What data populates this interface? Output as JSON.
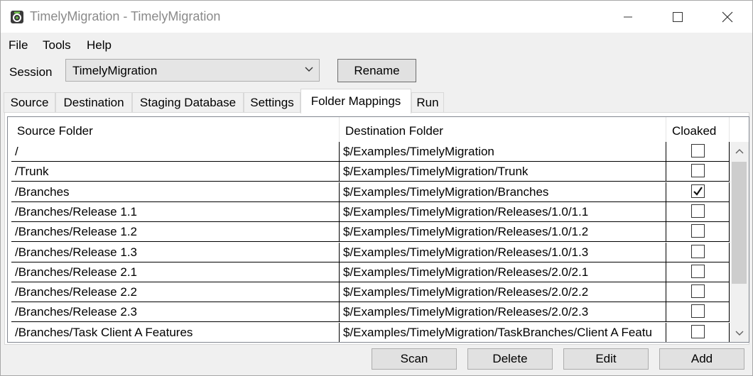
{
  "window": {
    "title": "TimelyMigration - TimelyMigration"
  },
  "menu": {
    "items": [
      "File",
      "Tools",
      "Help"
    ]
  },
  "session": {
    "label": "Session",
    "value": "TimelyMigration",
    "rename_label": "Rename"
  },
  "tabs": [
    {
      "label": "Source",
      "active": false
    },
    {
      "label": "Destination",
      "active": false
    },
    {
      "label": "Staging Database",
      "active": false
    },
    {
      "label": "Settings",
      "active": false
    },
    {
      "label": "Folder Mappings",
      "active": true
    },
    {
      "label": "Run",
      "active": false
    }
  ],
  "grid": {
    "columns": [
      "Source Folder",
      "Destination Folder",
      "Cloaked"
    ],
    "rows": [
      {
        "source": "/",
        "destination": "$/Examples/TimelyMigration",
        "cloaked": false
      },
      {
        "source": "/Trunk",
        "destination": "$/Examples/TimelyMigration/Trunk",
        "cloaked": false
      },
      {
        "source": "/Branches",
        "destination": "$/Examples/TimelyMigration/Branches",
        "cloaked": true
      },
      {
        "source": "/Branches/Release 1.1",
        "destination": "$/Examples/TimelyMigration/Releases/1.0/1.1",
        "cloaked": false
      },
      {
        "source": "/Branches/Release 1.2",
        "destination": "$/Examples/TimelyMigration/Releases/1.0/1.2",
        "cloaked": false
      },
      {
        "source": "/Branches/Release 1.3",
        "destination": "$/Examples/TimelyMigration/Releases/1.0/1.3",
        "cloaked": false
      },
      {
        "source": "/Branches/Release 2.1",
        "destination": "$/Examples/TimelyMigration/Releases/2.0/2.1",
        "cloaked": false
      },
      {
        "source": "/Branches/Release 2.2",
        "destination": "$/Examples/TimelyMigration/Releases/2.0/2.2",
        "cloaked": false
      },
      {
        "source": "/Branches/Release 2.3",
        "destination": "$/Examples/TimelyMigration/Releases/2.0/2.3",
        "cloaked": false
      },
      {
        "source": "/Branches/Task Client A Features",
        "destination": "$/Examples/TimelyMigration/TaskBranches/Client A Featu",
        "cloaked": false
      }
    ]
  },
  "actions": {
    "scan_label": "Scan",
    "delete_label": "Delete",
    "edit_label": "Edit",
    "add_label": "Add"
  },
  "icons": {
    "app": "app-gear-icon",
    "minimize": "minimize-icon",
    "maximize": "maximize-icon",
    "close": "close-icon",
    "dropdown": "chevron-down-icon",
    "check": "checkmark-icon",
    "scroll_up": "scroll-up-arrow-icon",
    "scroll_down": "scroll-down-arrow-icon"
  }
}
